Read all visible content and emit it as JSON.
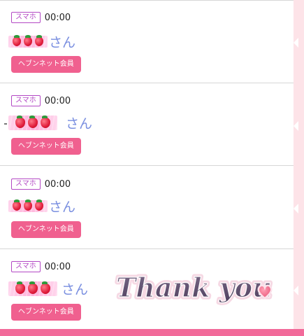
{
  "entries": [
    {
      "badge": "スマホ",
      "time": "00:00",
      "name_suffix": "さん",
      "member_label": "ヘブンネット会員"
    },
    {
      "badge": "スマホ",
      "time": "00:00",
      "name_suffix": "さん",
      "member_label": "ヘブンネット会員"
    },
    {
      "badge": "スマホ",
      "time": "00:00",
      "name_suffix": "さん",
      "member_label": "ヘブンネット会員"
    },
    {
      "badge": "スマホ",
      "time": "00:00",
      "name_suffix": "さん",
      "member_label": "ヘブンネット会員"
    }
  ],
  "sticker": {
    "text": "Thank you"
  },
  "colors": {
    "accent": "#f0608f",
    "badge": "#b348c4",
    "name": "#7a8fe0",
    "sidebar": "#fde3e8",
    "bottom_bar": "#f26a9a"
  },
  "icons": {
    "name_mask": "strawberry-icon",
    "sticker_heart": "heart-icon",
    "sidebar_marker": "arrow-left-icon"
  }
}
